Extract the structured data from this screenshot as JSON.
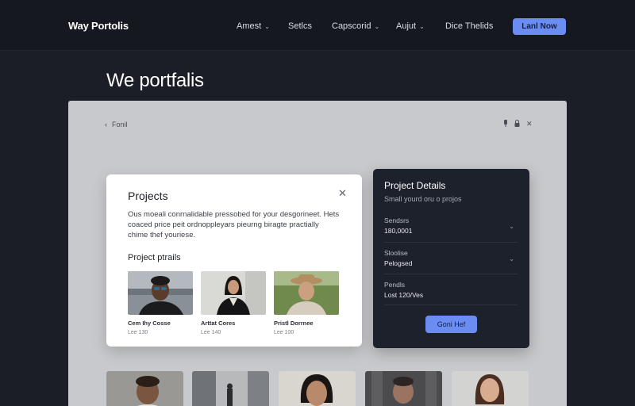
{
  "header": {
    "brand": "Way Portolis",
    "nav": [
      {
        "label": "Amest",
        "has_chevron": true
      },
      {
        "label": "Setlcs",
        "has_chevron": false
      },
      {
        "label": "Capscorid",
        "has_chevron": true
      },
      {
        "label": "Aujut",
        "has_chevron": true
      },
      {
        "label": "Dice Thelids",
        "has_chevron": false
      }
    ],
    "cta_label": "Lanl Now"
  },
  "page": {
    "title": "We portfalis"
  },
  "canvas": {
    "back_label": "Fonil",
    "back_icon": "chevron-left-icon",
    "window_icons": [
      "pin-icon",
      "lock-icon",
      "close-icon"
    ]
  },
  "modal": {
    "title": "Projects",
    "close_icon": "close-icon",
    "description": "Ous moeali conrnalidable pressobed for your desgorineet. Hets coaced price peit ordnoppleyars pieurng biragte practially chime thef youriese.",
    "subtitle": "Project ptrails",
    "items": [
      {
        "name": "Cem Ihy Cosse",
        "meta": "Lee 130"
      },
      {
        "name": "Arttat Cores",
        "meta": "Lee 140"
      },
      {
        "name": "Pristl Dorrnee",
        "meta": "Lee 100"
      }
    ]
  },
  "details": {
    "title": "Project Details",
    "subtitle": "Small yourd oru o projos",
    "fields": [
      {
        "label": "Sendsrs",
        "value": "180,0001",
        "has_chevron": true
      },
      {
        "label": "Sloolise",
        "value": "Pelogsed",
        "has_chevron": true
      },
      {
        "label": "Pendls",
        "value": "Lost 120/Ves",
        "has_chevron": false
      }
    ],
    "button_label": "Goni Hef"
  },
  "colors": {
    "background": "#1b1e26",
    "accent": "#6b8df2",
    "panel": "#1d212b",
    "canvas": "#c7c9cc"
  }
}
